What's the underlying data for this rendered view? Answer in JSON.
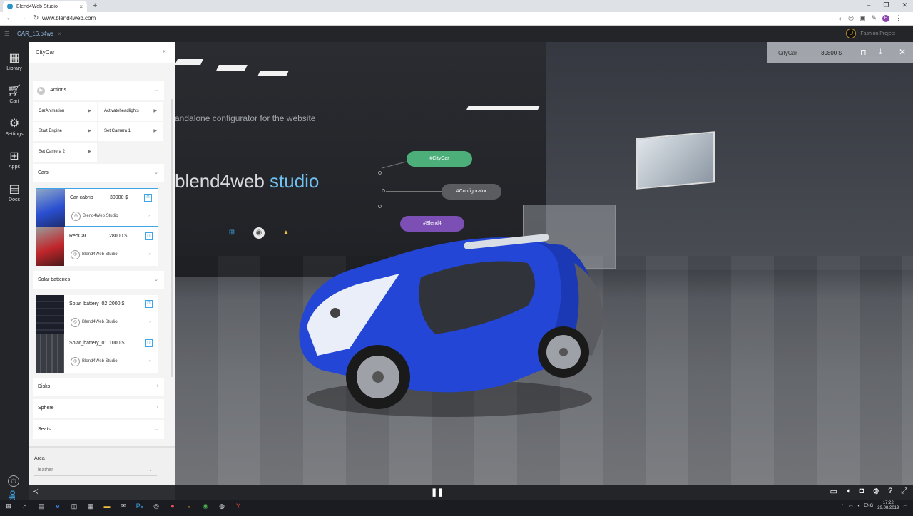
{
  "browser": {
    "tab_title": "Blend4Web Studio",
    "tab_close": "×",
    "new_tab": "+",
    "url": "www.blend4web.com",
    "window_controls": [
      "–",
      "❐",
      "✕"
    ],
    "user_initial": "H"
  },
  "app": {
    "file_tab": "CAR_16.b4ws",
    "file_tab_close": "×",
    "project": "Fashion Project",
    "project_logo": "D"
  },
  "leftnav": [
    {
      "label": "Library",
      "icon": "grid-icon"
    },
    {
      "label": "Cart",
      "icon": "cart-icon"
    },
    {
      "label": "Settings",
      "icon": "gear-icon"
    },
    {
      "label": "Apps",
      "icon": "apps-icon"
    },
    {
      "label": "Docs",
      "icon": "docs-icon"
    }
  ],
  "brand": {
    "part1": "blend4web",
    "part2": " studio"
  },
  "panel": {
    "title": "CityCar",
    "close": "×",
    "actions_label": "Actions",
    "actions": [
      "CarAnimation",
      "Activateheadlights",
      "Start Engine",
      "Set Camera 1",
      "Set Camera 2"
    ],
    "sections": {
      "cars": "Cars",
      "solar": "Solar batteries",
      "disks": "Disks",
      "sphere": "Sphere",
      "seats": "Seats"
    },
    "cars": [
      {
        "name": "Car-cabrio",
        "price": "30000 $",
        "publisher": "Blend4Web Studio"
      },
      {
        "name": "RedCar",
        "price": "28000 $",
        "publisher": "Blend4Web Studio"
      }
    ],
    "solar": [
      {
        "name": "Solar_battery_02",
        "price": "2000 $",
        "publisher": "Blend4Web Studio"
      },
      {
        "name": "Solar_battery_01",
        "price": "1000 $",
        "publisher": "Blend4Web Studio"
      }
    ],
    "area_label": "Area",
    "area_value": "leather"
  },
  "scene": {
    "tagline": "andalone configurator for the website",
    "title_part1": "blend4web",
    "title_part2": " studio",
    "tags": [
      "#CityCar",
      "#Configurator",
      "#Blend4"
    ]
  },
  "configurator": {
    "name": "CityCar",
    "price": "30800 $"
  },
  "taskbar": {
    "lang": "ENG",
    "time": "17:22",
    "date": "29.08.2019"
  },
  "colors": {
    "accent": "#3ea6e6",
    "tag_green": "#4caf7a",
    "tag_grey": "#5a5c60",
    "tag_purple": "#7b4fb3",
    "car_blue": "#2446d6"
  }
}
